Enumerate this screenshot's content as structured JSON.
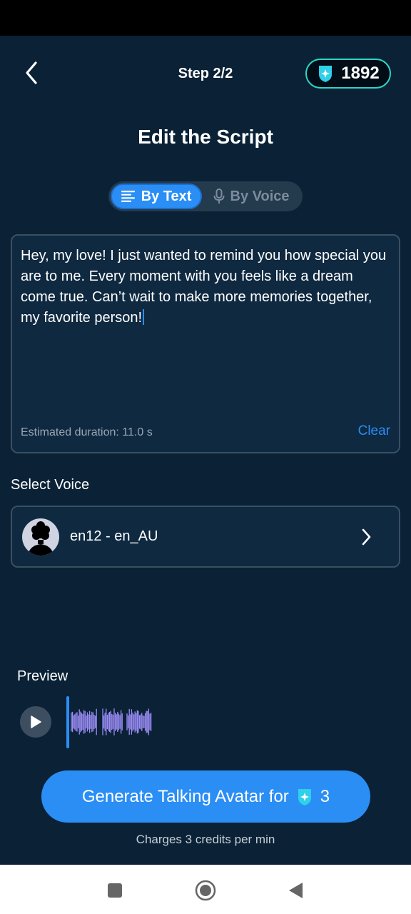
{
  "header": {
    "step": "Step 2/2",
    "credits": "1892"
  },
  "title": "Edit the Script",
  "mode_tabs": {
    "by_text": "By Text",
    "by_voice": "By Voice",
    "selected": "by_text"
  },
  "script": {
    "text": "Hey, my love! I just wanted to remind you how special you are to me. Every moment with you feels like a dream come true. Can’t wait to make more memories together, my favorite person!",
    "duration": "Estimated duration: 11.0 s",
    "clear_label": "Clear"
  },
  "voice": {
    "section_label": "Select Voice",
    "selected": "en12 - en_AU"
  },
  "preview": {
    "label": "Preview",
    "playing": false
  },
  "generate": {
    "label": "Generate Talking Avatar for",
    "cost": "3",
    "note": "Charges 3 credits per min"
  },
  "colors": {
    "background": "#0a2136",
    "accent": "#2a8ef5",
    "credit_outline": "#2ed5c6",
    "gem": "#2fd0e8",
    "waveform": "#9b8cf5"
  },
  "icons": {
    "back": "chevron-left-icon",
    "gem": "gem-icon",
    "text_mode": "text-lines-icon",
    "voice_mode": "microphone-icon",
    "voice_chevron": "chevron-right-icon",
    "play": "play-icon",
    "nav_recents": "square-icon",
    "nav_home": "circle-icon",
    "nav_back": "triangle-back-icon"
  }
}
